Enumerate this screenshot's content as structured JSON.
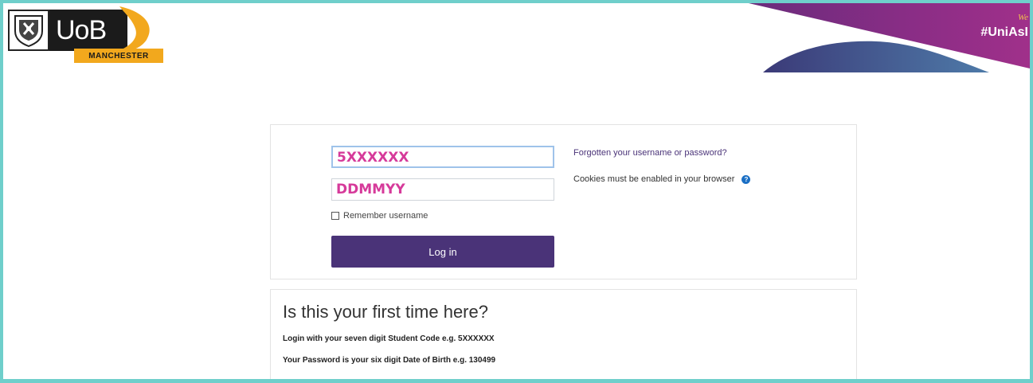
{
  "header": {
    "logo": {
      "name": "UoB",
      "city": "MANCHESTER"
    },
    "hashtag": "#UniAsI",
    "hashtag_script": "We"
  },
  "login": {
    "username_value": "5XXXXXX",
    "password_value": "DDMMYY",
    "remember_label": "Remember username",
    "login_button": "Log in",
    "forgot_link": "Forgotten your username or password?",
    "cookies_text": "Cookies must be enabled in your browser"
  },
  "first_time": {
    "title": "Is this your first time here?",
    "line1": "Login with your seven digit Student Code e.g. 5XXXXXX",
    "line2": "Your Password is your six digit Date of Birth e.g. 130499"
  },
  "colors": {
    "accent": "#4a3378",
    "frame": "#6fcfcb",
    "input_text": "#d63a9a",
    "logo_yellow": "#f2a81d"
  }
}
